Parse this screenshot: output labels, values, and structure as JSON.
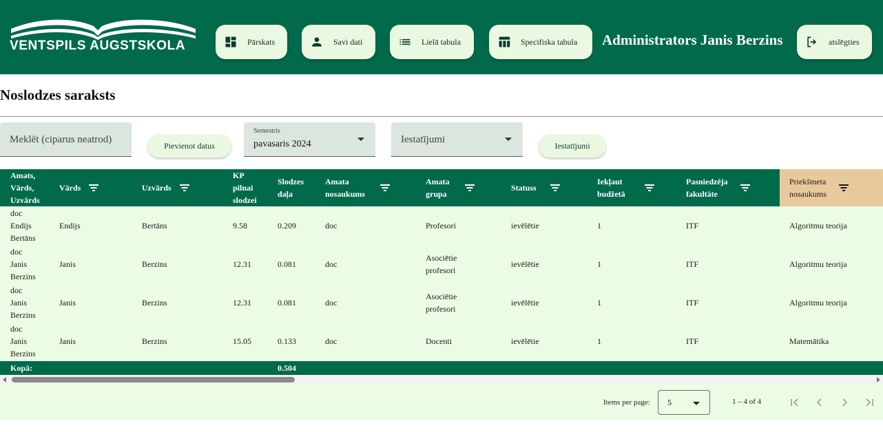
{
  "header": {
    "logo_text": "VENTSPILS AUGSTSKOLA",
    "nav": [
      {
        "label": "Pārskats",
        "icon": "dashboard-icon"
      },
      {
        "label": "Savi dati",
        "icon": "person-icon"
      },
      {
        "label": "Lielā tabula",
        "icon": "list-icon"
      },
      {
        "label": "Specifiska tabula",
        "icon": "table-icon"
      }
    ],
    "admin_title": "Administrators Janis Berzins",
    "logout": {
      "label": "atslēgties",
      "icon": "logout-icon"
    },
    "colors": {
      "primary": "#006a4b",
      "button_bg": "#eaf8e2",
      "row_bg": "#ecfbe4",
      "accent_header": "#e8c99c"
    }
  },
  "page": {
    "title": "Noslodzes saraksts"
  },
  "controls": {
    "search_placeholder": "Meklēt (ciparus neatrod)",
    "add_button": "Pievienot datus",
    "semester_label": "Semestris",
    "semester_value": "pavasaris 2024",
    "settings_placeholder": "Iestatījumi",
    "settings_button": "Iestatījumi"
  },
  "table": {
    "columns": [
      {
        "label": "Amats,\nVārds,\nUzvārds",
        "filter": false
      },
      {
        "label": "Vārds",
        "filter": true
      },
      {
        "label": "Uzvārds",
        "filter": true
      },
      {
        "label": "KP\npilnai\nslodzei",
        "filter": false
      },
      {
        "label": "Slodzes\ndaļa",
        "filter": false
      },
      {
        "label": "Amata\nnosaukums",
        "filter": true
      },
      {
        "label": "Amata\ngrupa",
        "filter": true
      },
      {
        "label": "Statuss",
        "filter": true
      },
      {
        "label": "Iekļaut\nbudžetā",
        "filter": true
      },
      {
        "label": "Pasniedzēja\nfakultāte",
        "filter": true
      },
      {
        "label": "Priekšmeta\nnosaukums",
        "filter": true
      }
    ],
    "rows": [
      [
        "doc\nEndijs\nBertāns",
        "Endijs",
        "Bertāns",
        "9.58",
        "0.209",
        "doc",
        "Profesori",
        "ievēlētie",
        "1",
        "ITF",
        "Algoritmu teorija"
      ],
      [
        "doc\nJanis\nBerzins",
        "Janis",
        "Berzins",
        "12.31",
        "0.081",
        "doc",
        "Asociētie\nprofesori",
        "ievēlētie",
        "1",
        "ITF",
        "Algoritmu teorija"
      ],
      [
        "doc\nJanis\nBerzins",
        "Janis",
        "Berzins",
        "12.31",
        "0.081",
        "doc",
        "Asociētie\nprofesori",
        "ievēlētie",
        "1",
        "ITF",
        "Algoritmu teorija"
      ],
      [
        "doc\nJanis\nBerzins",
        "Janis",
        "Berzins",
        "15.05",
        "0.133",
        "doc",
        "Docenti",
        "ievēlētie",
        "1",
        "ITF",
        "Matemātika"
      ]
    ],
    "footer": {
      "label": "Kopā:",
      "total": "0.504"
    }
  },
  "paginator": {
    "items_per_page_label": "Items per page:",
    "items_per_page": "5",
    "range": "1 – 4 of 4"
  }
}
